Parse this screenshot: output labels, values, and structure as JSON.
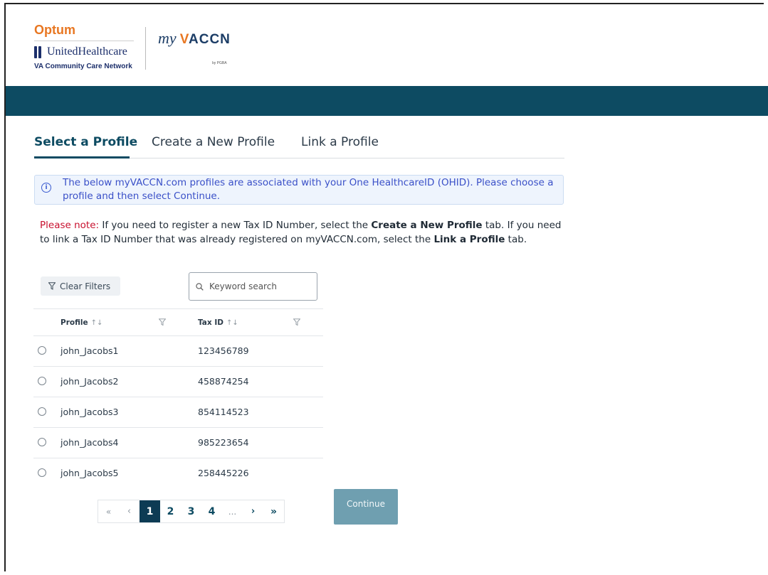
{
  "brand": {
    "optum": "Optum",
    "uhc": "UnitedHealthcare",
    "network": "VA Community Care Network",
    "my": "my",
    "vaccn_v": "V",
    "vaccn_rest": "ACCN",
    "by_pgba": "by PGBA",
    "orange": "#e87722",
    "navy": "#1c2f6b",
    "teal": "#0d4b62"
  },
  "tabs": [
    {
      "label": "Select a Profile",
      "active": true
    },
    {
      "label": "Create a New Profile",
      "active": false
    },
    {
      "label": "Link a Profile",
      "active": false
    }
  ],
  "info_banner": {
    "icon": "info-icon",
    "text": "The below myVACCN.com profiles are associated with your One HealthcareID (OHID). Please choose a profile and then select Continue."
  },
  "note": {
    "prefix": "Please note:",
    "part1": " If you need to register a new Tax ID Number, select the ",
    "bold1": "Create a New Profile",
    "part2": " tab. If you need to link a Tax ID Number that was already registered on myVACCN.com, select the ",
    "bold2": "Link a Profile",
    "part3": " tab."
  },
  "filters": {
    "clear_label": "Clear Filters",
    "search_placeholder": "Keyword search"
  },
  "table": {
    "columns": [
      "Profile",
      "Tax ID"
    ],
    "sort_glyph": "↑↓",
    "rows": [
      {
        "profile": "john_Jacobs1",
        "tax_id": "123456789"
      },
      {
        "profile": "john_Jacobs2",
        "tax_id": "458874254"
      },
      {
        "profile": "john_Jacobs3",
        "tax_id": "854114523"
      },
      {
        "profile": "john_Jacobs4",
        "tax_id": "985223654"
      },
      {
        "profile": "john_Jacobs5",
        "tax_id": "258445226"
      }
    ]
  },
  "pagination": {
    "first": "«",
    "prev": "‹",
    "pages": [
      "1",
      "2",
      "3",
      "4"
    ],
    "ellipsis": "...",
    "next": "›",
    "last": "»",
    "current": "1"
  },
  "continue_label": "Continue"
}
